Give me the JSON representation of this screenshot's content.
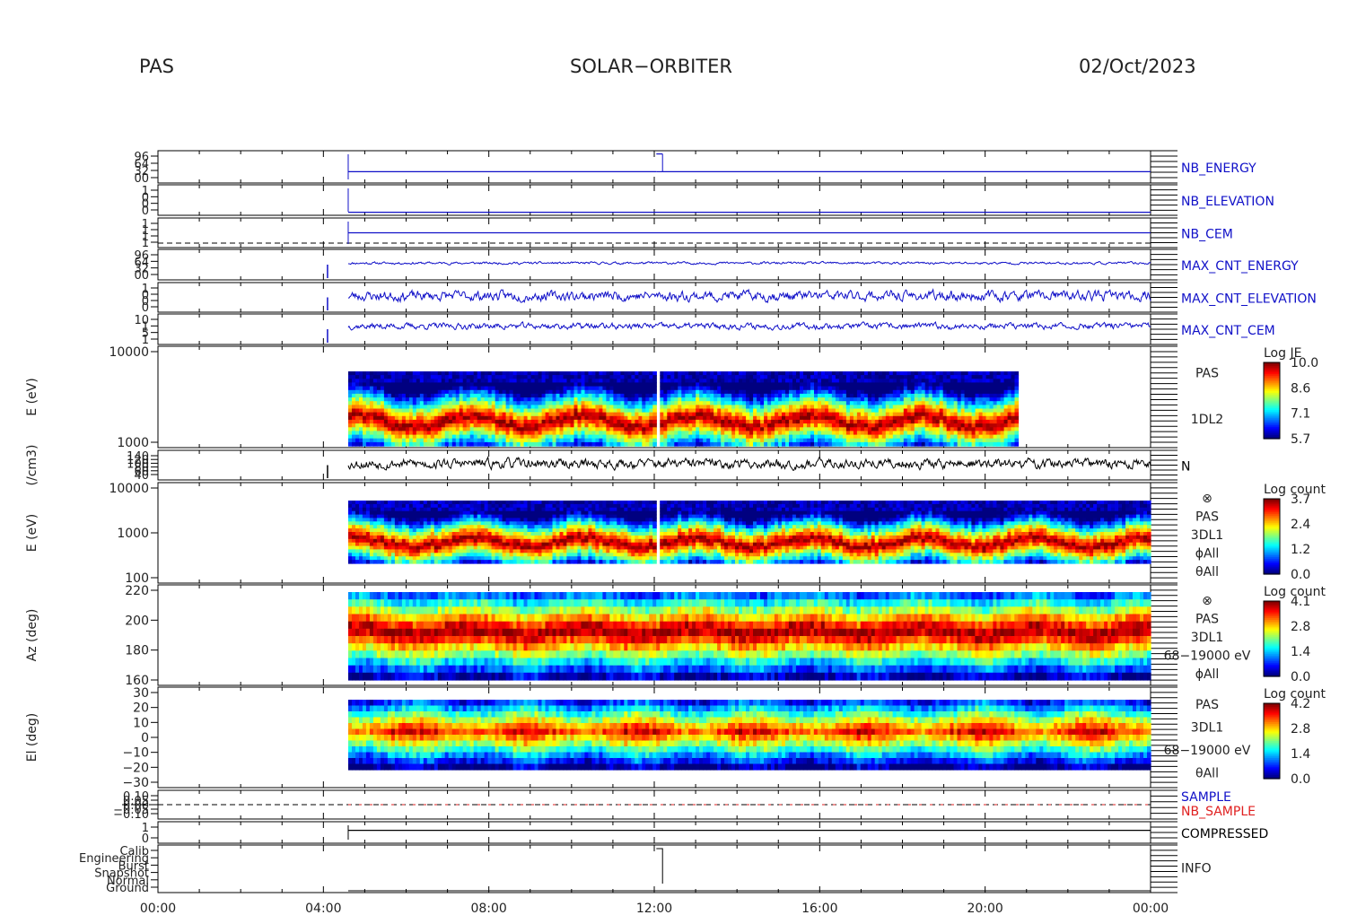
{
  "header": {
    "instrument": "PAS",
    "mission": "SOLAR−ORBITER",
    "date": "02/Oct/2023"
  },
  "colors": {
    "blue": "#1010c8",
    "red": "#e02020",
    "black": "#000000",
    "text": "#222222",
    "axis": "#000000"
  },
  "chart_data": {
    "type": "multi-panel time series and spectrograms",
    "x_range": [
      "00:00",
      "24:00"
    ],
    "x_ticks": [
      "00:00",
      "04:00",
      "08:00",
      "12:00",
      "16:00",
      "20:00",
      "00:00"
    ],
    "panels": [
      {
        "id": "nb_energy",
        "type": "line",
        "label": "NB_ENERGY",
        "color": "#1010c8",
        "y_ticks": [
          "96",
          "64",
          "32",
          "00"
        ],
        "segments": [
          {
            "t0": 4.6,
            "t1": 12.05,
            "level": 0.35
          },
          {
            "t0": 12.05,
            "t1": 12.2,
            "level": 0.35,
            "step": 0.9
          },
          {
            "t0": 12.2,
            "t1": 24,
            "level": 0.35
          }
        ]
      },
      {
        "id": "nb_elevation",
        "type": "line",
        "label": "NB_ELEVATION",
        "color": "#1010c8",
        "y_ticks": [
          "1",
          "0",
          "0",
          "0"
        ],
        "segments": [
          {
            "t0": 4.6,
            "t1": 24,
            "level": 0.1
          }
        ]
      },
      {
        "id": "nb_cem",
        "type": "line",
        "label": "NB_CEM",
        "color": "#1010c8",
        "y_ticks": [
          "1",
          "1",
          "1",
          "1"
        ],
        "segments": [
          {
            "t0": 4.6,
            "t1": 24,
            "level": 0.5
          }
        ],
        "dashed_black": true
      },
      {
        "id": "max_cnt_energy",
        "type": "noisy_line",
        "label": "MAX_CNT_ENERGY",
        "color": "#1010c8",
        "y_ticks": [
          "96",
          "64",
          "32",
          "00"
        ],
        "base": 0.55,
        "amp": 0.06,
        "seed": 11
      },
      {
        "id": "max_cnt_elevation",
        "type": "noisy_line",
        "label": "MAX_CNT_ELEVATION",
        "color": "#1010c8",
        "y_ticks": [
          "1",
          "0",
          "0",
          "0"
        ],
        "base": 0.55,
        "amp": 0.25,
        "seed": 23
      },
      {
        "id": "max_cnt_cem",
        "type": "noisy_line",
        "label": "MAX_CNT_CEM",
        "color": "#1010c8",
        "y_ticks": [
          "10",
          "1",
          "5",
          "1"
        ],
        "base": 0.6,
        "amp": 0.15,
        "seed": 37
      },
      {
        "id": "pas_l2",
        "type": "spectrogram",
        "ylabel": "E (eV)",
        "y_ticks": [
          "10000",
          "1000"
        ],
        "t0": 4.6,
        "t1": 20.8,
        "gap": 12.05,
        "colorbar": {
          "title": "Log JE",
          "labels": [
            "10.0",
            "8.6",
            "7.1",
            "5.7"
          ]
        },
        "side_labels": [
          "PAS",
          "1DL2"
        ],
        "style": "energy_l2"
      },
      {
        "id": "density",
        "type": "noisy_line",
        "ylabel": "(/cm3)",
        "label": "N",
        "color": "#000000",
        "y_ticks": [
          "140",
          "120",
          "100",
          "80",
          "60",
          "40"
        ],
        "base": 0.55,
        "amp": 0.25,
        "seed": 53
      },
      {
        "id": "pas_3dl1_e",
        "type": "spectrogram",
        "ylabel": "E (eV)",
        "y_ticks": [
          "10000",
          "1000",
          "100"
        ],
        "t0": 4.6,
        "t1": 24,
        "gap": 12.05,
        "colorbar": {
          "title": "Log count",
          "labels": [
            "3.7",
            "2.4",
            "1.2",
            "0.0"
          ]
        },
        "side_labels": [
          "⊗",
          "PAS",
          "3DL1",
          "ϕAll",
          "θAll"
        ],
        "style": "energy_l1"
      },
      {
        "id": "pas_3dl1_az",
        "type": "spectrogram",
        "ylabel": "Az (deg)",
        "y_ticks": [
          "220",
          "200",
          "180",
          "160"
        ],
        "t0": 4.6,
        "t1": 24,
        "colorbar": {
          "title": "Log count",
          "labels": [
            "4.1",
            "2.8",
            "1.4",
            "0.0"
          ]
        },
        "side_labels": [
          "⊗",
          "PAS",
          "3DL1",
          "68−19000 eV",
          "ϕAll"
        ],
        "style": "azimuth"
      },
      {
        "id": "pas_3dl1_el",
        "type": "spectrogram",
        "ylabel": "El (deg)",
        "y_ticks": [
          "30",
          "20",
          "10",
          "0",
          "−10",
          "−20",
          "−30"
        ],
        "t0": 4.6,
        "t1": 24,
        "colorbar": {
          "title": "Log count",
          "labels": [
            "4.2",
            "2.8",
            "1.4",
            "0.0"
          ]
        },
        "side_labels": [
          "PAS",
          "3DL1",
          "68−19000 eV",
          "θAll"
        ],
        "style": "elevation"
      },
      {
        "id": "sample",
        "type": "sample",
        "labels": [
          "SAMPLE",
          "NB_SAMPLE"
        ],
        "y_ticks": [
          "0.10",
          "0.05",
          "0.00",
          "−0.05",
          "−0.10"
        ]
      },
      {
        "id": "compressed",
        "type": "line",
        "label": "COMPRESSED",
        "color": "#000000",
        "y_ticks": [
          "1",
          "0"
        ],
        "segments": [
          {
            "t0": 4.6,
            "t1": 24,
            "level": 0.6
          }
        ]
      },
      {
        "id": "info",
        "type": "info",
        "label": "INFO",
        "y_ticks": [
          "Calib",
          "Engineering",
          "Burst",
          "Snapshot",
          "Normal",
          "Ground"
        ]
      }
    ]
  }
}
